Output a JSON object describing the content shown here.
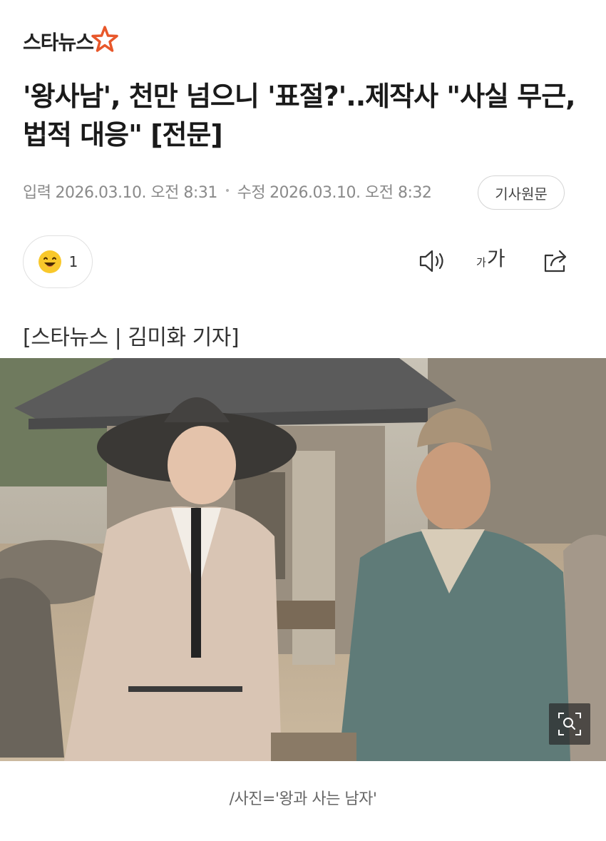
{
  "header": {
    "logo_text": "스타뉴스",
    "logo_accent_color": "#e8572a"
  },
  "article": {
    "headline": "'왕사남', 천만 넘으니 '표절?'..제작사 \"사실 무근, 법적 대응\" [전문]",
    "input_label": "입력",
    "input_time": "2026.03.10. 오전 8:31",
    "edit_label": "수정",
    "edit_time": "2026.03.10. 오전 8:32",
    "origin_button": "기사원문",
    "byline": "[스타뉴스 | 김미화 기자]",
    "photo_caption": "/사진='왕과 사는 남자'"
  },
  "toolbar": {
    "reaction_icon": "smile-emoji-icon",
    "reaction_count": "1",
    "audio_icon": "speaker-icon",
    "font_small": "가",
    "font_big": "가",
    "share_icon": "share-icon"
  },
  "photo": {
    "zoom_icon": "zoom-search-icon"
  }
}
